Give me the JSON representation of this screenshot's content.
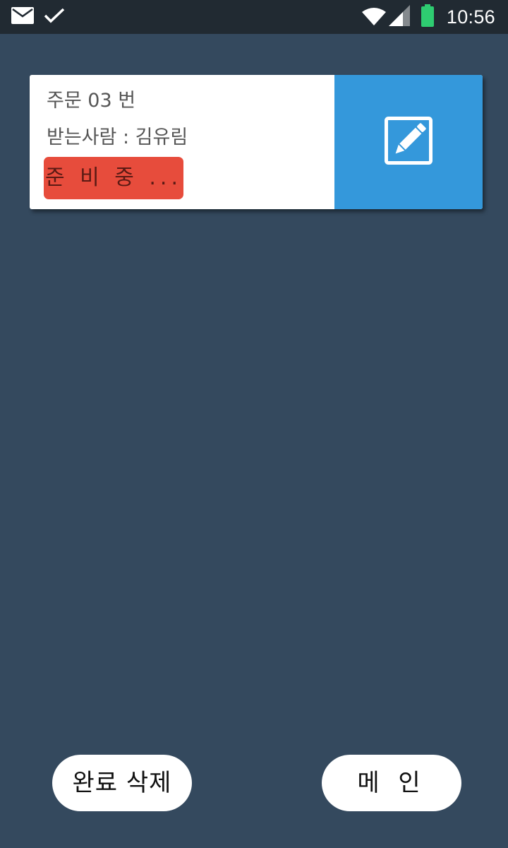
{
  "status_bar": {
    "time": "10:56",
    "icons": [
      "mail-icon",
      "check-icon",
      "wifi-icon",
      "signal-icon",
      "battery-icon"
    ],
    "battery_color": "#2ecc71"
  },
  "order": {
    "title": "주문 03 번",
    "recipient_label": "받는사람 :",
    "recipient_name": "김유림",
    "status": "준 비 중 ...",
    "status_color": "#e74c3c",
    "edit_icon": "edit-pencil-icon",
    "edit_color": "#3498db"
  },
  "buttons": {
    "delete_completed": "완료 삭제",
    "main": "메 인"
  },
  "colors": {
    "background": "#34495e",
    "status_bar": "#212a32"
  }
}
